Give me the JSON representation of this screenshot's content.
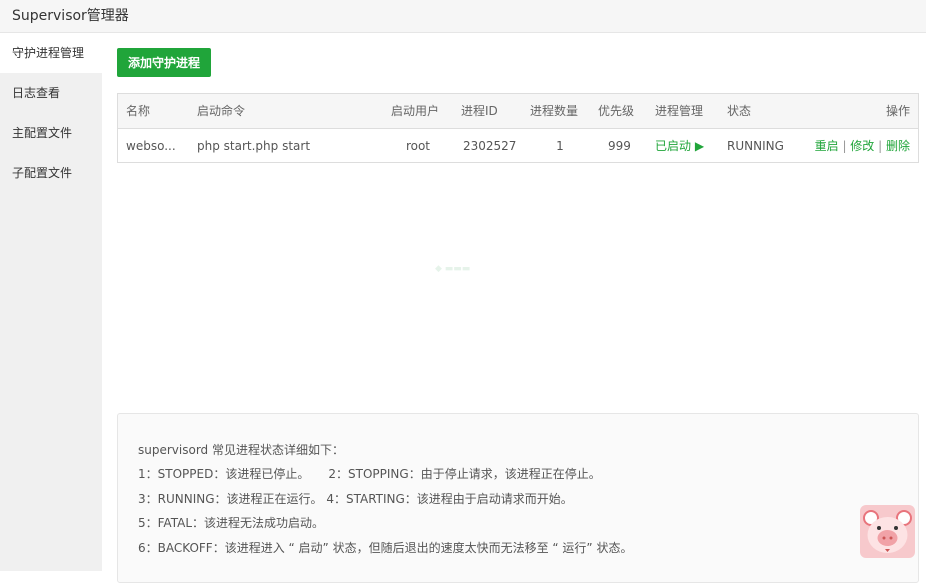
{
  "header": {
    "title": "Supervisor管理器"
  },
  "sidebar": {
    "items": [
      {
        "label": "守护进程管理"
      },
      {
        "label": "日志查看"
      },
      {
        "label": "主配置文件"
      },
      {
        "label": "子配置文件"
      }
    ]
  },
  "toolbar": {
    "add_label": "添加守护进程"
  },
  "table": {
    "columns": [
      "名称",
      "启动命令",
      "启动用户",
      "进程ID",
      "进程数量",
      "优先级",
      "进程管理",
      "状态",
      "操作"
    ],
    "rows": [
      {
        "name": "webso...",
        "command": "php start.php start",
        "user": "root",
        "pid": "2302527",
        "count": "1",
        "priority": "999",
        "manage": "已启动 ▶",
        "status": "RUNNING",
        "ops": [
          "重启",
          "修改",
          "删除"
        ]
      }
    ]
  },
  "info": {
    "lines": [
      "supervisord 常见进程状态详细如下：",
      "1：STOPPED：该进程已停止。     2：STOPPING：由于停止请求，该进程正在停止。",
      "3：RUNNING：该进程正在运行。 4：STARTING：该进程由于启动请求而开始。",
      "5：FATAL：该进程无法成功启动。",
      "6：BACKOFF：该进程进入 “ 启动” 状态，但随后退出的速度太快而无法移至 “ 运行” 状态。"
    ]
  },
  "colors": {
    "accent": "#20a53a"
  }
}
